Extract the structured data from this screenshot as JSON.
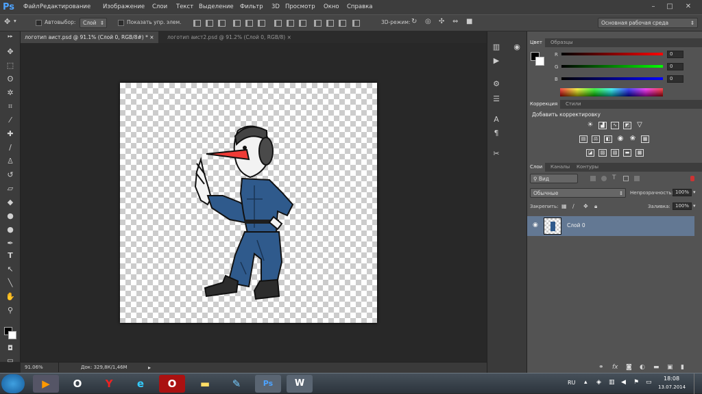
{
  "app": {
    "logo": "Ps"
  },
  "menu": [
    "Файл",
    "Редактирование",
    "Изображение",
    "Слои",
    "Текст",
    "Выделение",
    "Фильтр",
    "3D",
    "Просмотр",
    "Окно",
    "Справка"
  ],
  "window_buttons": [
    "–",
    "□",
    "✕"
  ],
  "options": {
    "autoselect_label": "Автовыбор:",
    "autoselect_value": "Слой",
    "show_controls_label": "Показать упр. элем.",
    "mode_3d_label": "3D-режим:",
    "workspace": "Основная рабочая среда"
  },
  "tabs": [
    {
      "label": "логотип аист.psd @ 91.1% (Слой 0, RGB/8#) *",
      "close": "×"
    },
    {
      "label": "логотип аист2.psd @ 91.2% (Слой 0, RGB/8)",
      "close": "×"
    }
  ],
  "status": {
    "zoom": "91.06%",
    "doc": "Док: 329,8К/1,46М"
  },
  "color_panel": {
    "tabs": [
      "Цвет",
      "Образцы"
    ],
    "channels": [
      {
        "label": "R",
        "value": "0"
      },
      {
        "label": "G",
        "value": "0"
      },
      {
        "label": "B",
        "value": "0"
      }
    ]
  },
  "adjustments_panel": {
    "tabs": [
      "Коррекция",
      "Стили"
    ],
    "title": "Добавить корректировку"
  },
  "layers_panel": {
    "tabs": [
      "Слои",
      "Каналы",
      "Контуры"
    ],
    "filter": "Вид",
    "blend_mode": "Обычные",
    "opacity_label": "Непрозрачность:",
    "opacity_value": "100%",
    "lock_label": "Закрепить:",
    "fill_label": "Заливка:",
    "fill_value": "100%",
    "layer_name": "Слой 0"
  },
  "taskbar": {
    "lang": "RU",
    "time": "18:08",
    "date": "13.07.2014"
  },
  "colors": {
    "selected_layer": "#637893",
    "canvas_bg": "#282828",
    "panel_bg": "#535353"
  }
}
